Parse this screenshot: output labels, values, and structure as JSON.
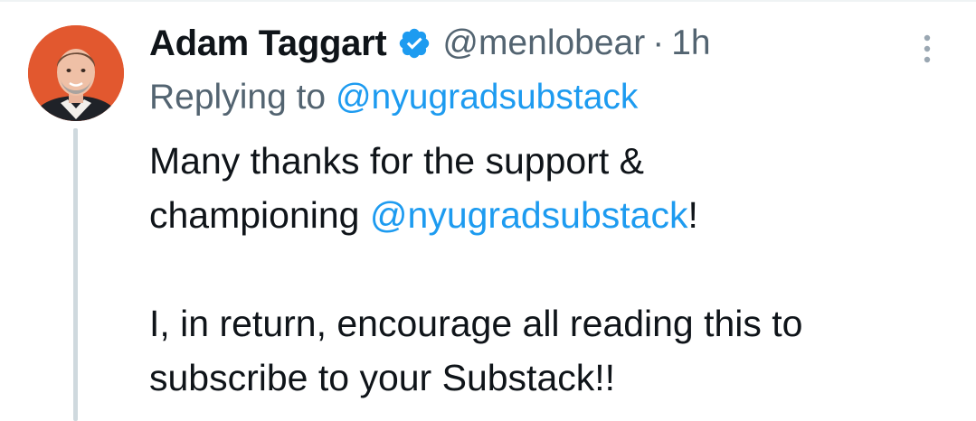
{
  "tweet": {
    "author": {
      "display_name": "Adam Taggart",
      "handle": "@menlobear",
      "verified": true,
      "avatar": "profile-photo"
    },
    "separator": "·",
    "timestamp": "1h",
    "reply": {
      "prefix": "Replying to",
      "mention": "@nyugradsubstack"
    },
    "body": {
      "line1": "Many thanks for the support &",
      "line2_prefix": "championing ",
      "line2_mention": "@nyugradsubstack",
      "line2_suffix": "!",
      "paragraph2_line1": "I, in return, encourage all reading this to",
      "paragraph2_line2": "subscribe to your Substack!!"
    },
    "icons": {
      "verified": "verified-badge-icon",
      "more": "more-options-icon"
    }
  },
  "colors": {
    "link": "#1d9bf0",
    "secondary_text": "#536471",
    "primary_text": "#0f1419",
    "thread_line": "#cfd9de"
  }
}
